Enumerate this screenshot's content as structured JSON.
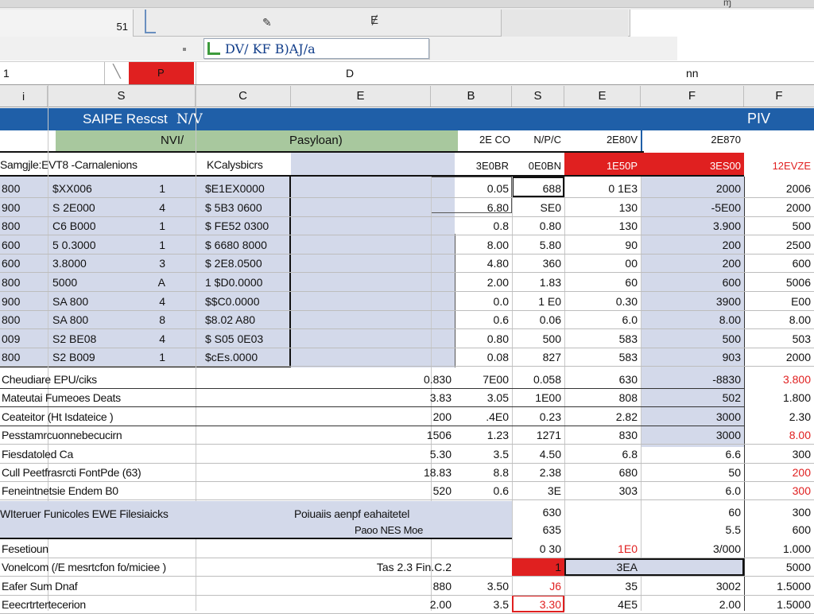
{
  "toolbar": {
    "cell_ref": "51",
    "fx_glyph": "Ɇ",
    "sheet_glyph": "ɱ"
  },
  "formula_row": {
    "tab_label": "DV/ KF B)AJ/a"
  },
  "name_row": {
    "name_box": "1",
    "red_cell": "P",
    "formula": "D",
    "right_text": "nn"
  },
  "columns": [
    "S",
    "C",
    "E",
    "B",
    "S",
    "E",
    "F",
    "F"
  ],
  "report": {
    "title": "SAIPE Rescst",
    "title_suffix": "N/V",
    "right_title": "PIV",
    "subheader_left": "NVI/",
    "subheader_mid": "Pasyloan)",
    "subheader_cols": [
      "2E CO",
      "N/P/C",
      "2E80V",
      "2E870"
    ],
    "colhead_label": "Samgjle:EVT8 -Carnalenions",
    "colhead_label2": "KCalysbicrs",
    "colhead_vals": [
      "3E0BR",
      "0E0BN",
      "1E50P",
      "3ES00",
      "12EVZE"
    ]
  },
  "data_rows": [
    {
      "a": "800",
      "b": "$XX006",
      "c": "1",
      "d": "$E1EX0000",
      "e": "0.05",
      "f": "688",
      "g": "0 1E3",
      "h": "2000",
      "i": "2006"
    },
    {
      "a": "900",
      "b": "S 2E000",
      "c": "4",
      "d": "$ 5B3 0600",
      "e": "6.80",
      "f": "SE0",
      "g": "130",
      "h": "-5E00",
      "i": "2000"
    },
    {
      "a": "800",
      "b": "C6 B000",
      "c": "1",
      "d": "$ FE52 0300",
      "e": "0.8",
      "f": "0.80",
      "g": "130",
      "h": "3.900",
      "i": "500"
    },
    {
      "a": "600",
      "b": "5 0.3000",
      "c": "1",
      "d": "$ 6680 8000",
      "e": "8.00",
      "f": "5.80",
      "g": "90",
      "h": "200",
      "i": "2500"
    },
    {
      "a": "600",
      "b": "3.8000",
      "c": "3",
      "d": "$ 2E8.0500",
      "e": "4.80",
      "f": "360",
      "g": "00",
      "h": "200",
      "i": "600"
    },
    {
      "a": "800",
      "b": "5000",
      "c": "A",
      "d": "1 $D0.0000",
      "e": "2.00",
      "f": "1.83",
      "g": "60",
      "h": "600",
      "i": "5006"
    },
    {
      "a": "900",
      "b": "SA 800",
      "c": "4",
      "d": "$$C0.0000",
      "e": "0.0",
      "f": "1 E0",
      "g": "0.30",
      "h": "3900",
      "i": "E00"
    },
    {
      "a": "800",
      "b": "SA 800",
      "c": "8",
      "d": "$8.02 A80",
      "e": "0.6",
      "f": "0.06",
      "g": "6.0",
      "h": "8.00",
      "i": "8.00"
    },
    {
      "a": "009",
      "b": "S2 BE08",
      "c": "4",
      "d": "$ S05 0E03",
      "e": "0.80",
      "f": "500",
      "g": "583",
      "h": "500",
      "i": "503"
    },
    {
      "a": "800",
      "b": "S2 B009",
      "c": "1",
      "d": "$cEs.0000",
      "e": "0.08",
      "f": "827",
      "g": "583",
      "h": "903",
      "i": "2000"
    }
  ],
  "lower_rows": [
    {
      "label": "Cheudiare EPU/ciks",
      "d": "0.830",
      "e": "7E00",
      "f": "0.058",
      "g": "630",
      "h": "-8830",
      "i": "3.800"
    },
    {
      "label": "Mateutai Fumeoes Deats",
      "d": "3.83",
      "e": "3.05",
      "f": "1E00",
      "g": "808",
      "h": "502",
      "i": "1.800"
    },
    {
      "label": "Ceateitor (Ht Isdateice )",
      "d": "200",
      "e": ".4E0",
      "f": "0.23",
      "g": "2.82",
      "h": "3000",
      "i": "2.30"
    },
    {
      "label": "Pesstamrcuonnebecucirn",
      "d": "1506",
      "e": "1.23",
      "f": "1271",
      "g": "830",
      "h": "3000",
      "i": "8.00"
    },
    {
      "label": "Fiesdatoled Ca",
      "d": "5.30",
      "e": "3.5",
      "f": "4.50",
      "g": "6.8",
      "h": "6.6",
      "i": "300"
    },
    {
      "label": "Cull Peetfrasrcti FontPde (63)",
      "d": "18.83",
      "e": "8.8",
      "f": "2.38",
      "g": "680",
      "h": "50",
      "i": "200"
    },
    {
      "label": "Feneintnetsie Endem B0",
      "d": "520",
      "e": "0.6",
      "f": "3E",
      "g": "303",
      "h": "6.0",
      "i": "300"
    }
  ],
  "section2": {
    "title": "WIteruer Funicoles EWE Filesiaicks",
    "mid_label": "Poiuaiis aenpf eahaitetel",
    "sub_label": "Paoo NES Moe",
    "rows": [
      {
        "g": "630",
        "h": "60",
        "i": "300"
      },
      {
        "g": "635",
        "h": "5.5",
        "i": "600"
      }
    ]
  },
  "bottom_rows": [
    {
      "label": "Fesetioun",
      "f": "0 30",
      "g": "1E0",
      "h": "3/000",
      "i": "1.000"
    },
    {
      "label": "Vonelcom (/E mesrtcfon fo/miciee )",
      "mid": "Tas 2.3 Fin.C.2",
      "e": "1",
      "g": "3EA",
      "i": "5000"
    },
    {
      "label": "Eafer Sum Dnaf",
      "d": "880",
      "e": "3.50",
      "f": "J6",
      "g": "35",
      "h": "3002",
      "i": "1.5000"
    },
    {
      "label": "Eeecrtrtertecerion",
      "d": "2.00",
      "e": "3.5",
      "f": "3.30",
      "g": "4E5",
      "h": "2.00",
      "i": "1.5000"
    }
  ],
  "colors": {
    "blue": "#1f5fa8",
    "red": "#e02020",
    "green": "#a8c89e",
    "lavender": "#d3d9ea"
  }
}
